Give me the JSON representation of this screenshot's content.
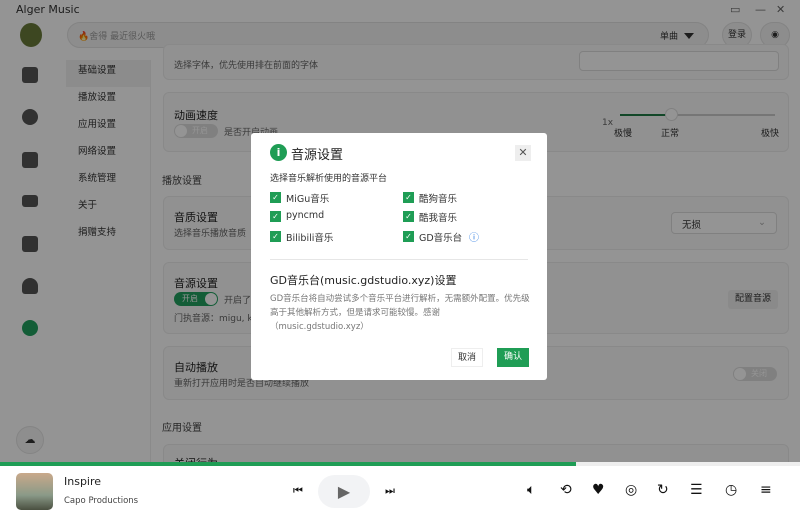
{
  "app": {
    "title": "Alger Music",
    "window_controls": [
      "mini-player",
      "minimize",
      "close"
    ]
  },
  "header": {
    "search_placeholder": "🔥舍得 最近很火哦",
    "search_type": "单曲",
    "login": "登录"
  },
  "settings_nav": [
    "基础设置",
    "播放设置",
    "应用设置",
    "网络设置",
    "系统管理",
    "关于",
    "捐赠支持"
  ],
  "content": {
    "font_desc": "选择字体，优先使用排在前面的字体",
    "animation": {
      "title": "动画速度",
      "toggle": "开启",
      "desc": "是否开启动画",
      "speed_value": "1x",
      "labels": [
        "极慢",
        "正常",
        "极快"
      ],
      "level": 0.33
    },
    "play_section": "播放设置",
    "quality": {
      "title": "音质设置",
      "desc": "选择音乐播放音质",
      "value": "无损"
    },
    "source": {
      "title": "音源设置",
      "toggle": "开启",
      "desc": "开启了...",
      "current": "门执音源：migu, k",
      "button": "配置音源"
    },
    "autoplay": {
      "title": "自动播放",
      "desc": "重新打开应用时是否自动继续播放",
      "toggle": "关闭"
    },
    "app_section": "应用设置",
    "close_behavior": "关闭行为"
  },
  "dialog": {
    "title": "音源设置",
    "subtitle": "选择音乐解析使用的音源平台",
    "options": [
      {
        "label": "MiGu音乐",
        "checked": true
      },
      {
        "label": "酷狗音乐",
        "checked": true
      },
      {
        "label": "pyncmd",
        "checked": true
      },
      {
        "label": "酷我音乐",
        "checked": true
      },
      {
        "label": "Bilibili音乐",
        "checked": true
      },
      {
        "label": "GD音乐台",
        "checked": true
      }
    ],
    "gd_title": "GD音乐台(music.gdstudio.xyz)设置",
    "gd_desc": "GD音乐台将自动尝试多个音乐平台进行解析，无需额外配置。优先级高于其他解析方式，但是请求可能较慢。感谢（music.gdstudio.xyz）",
    "cancel": "取消",
    "confirm": "确认"
  },
  "player": {
    "song": "Inspire",
    "artist": "Capo Productions",
    "progress": 0.72
  },
  "colors": {
    "accent": "#1f9d55"
  }
}
